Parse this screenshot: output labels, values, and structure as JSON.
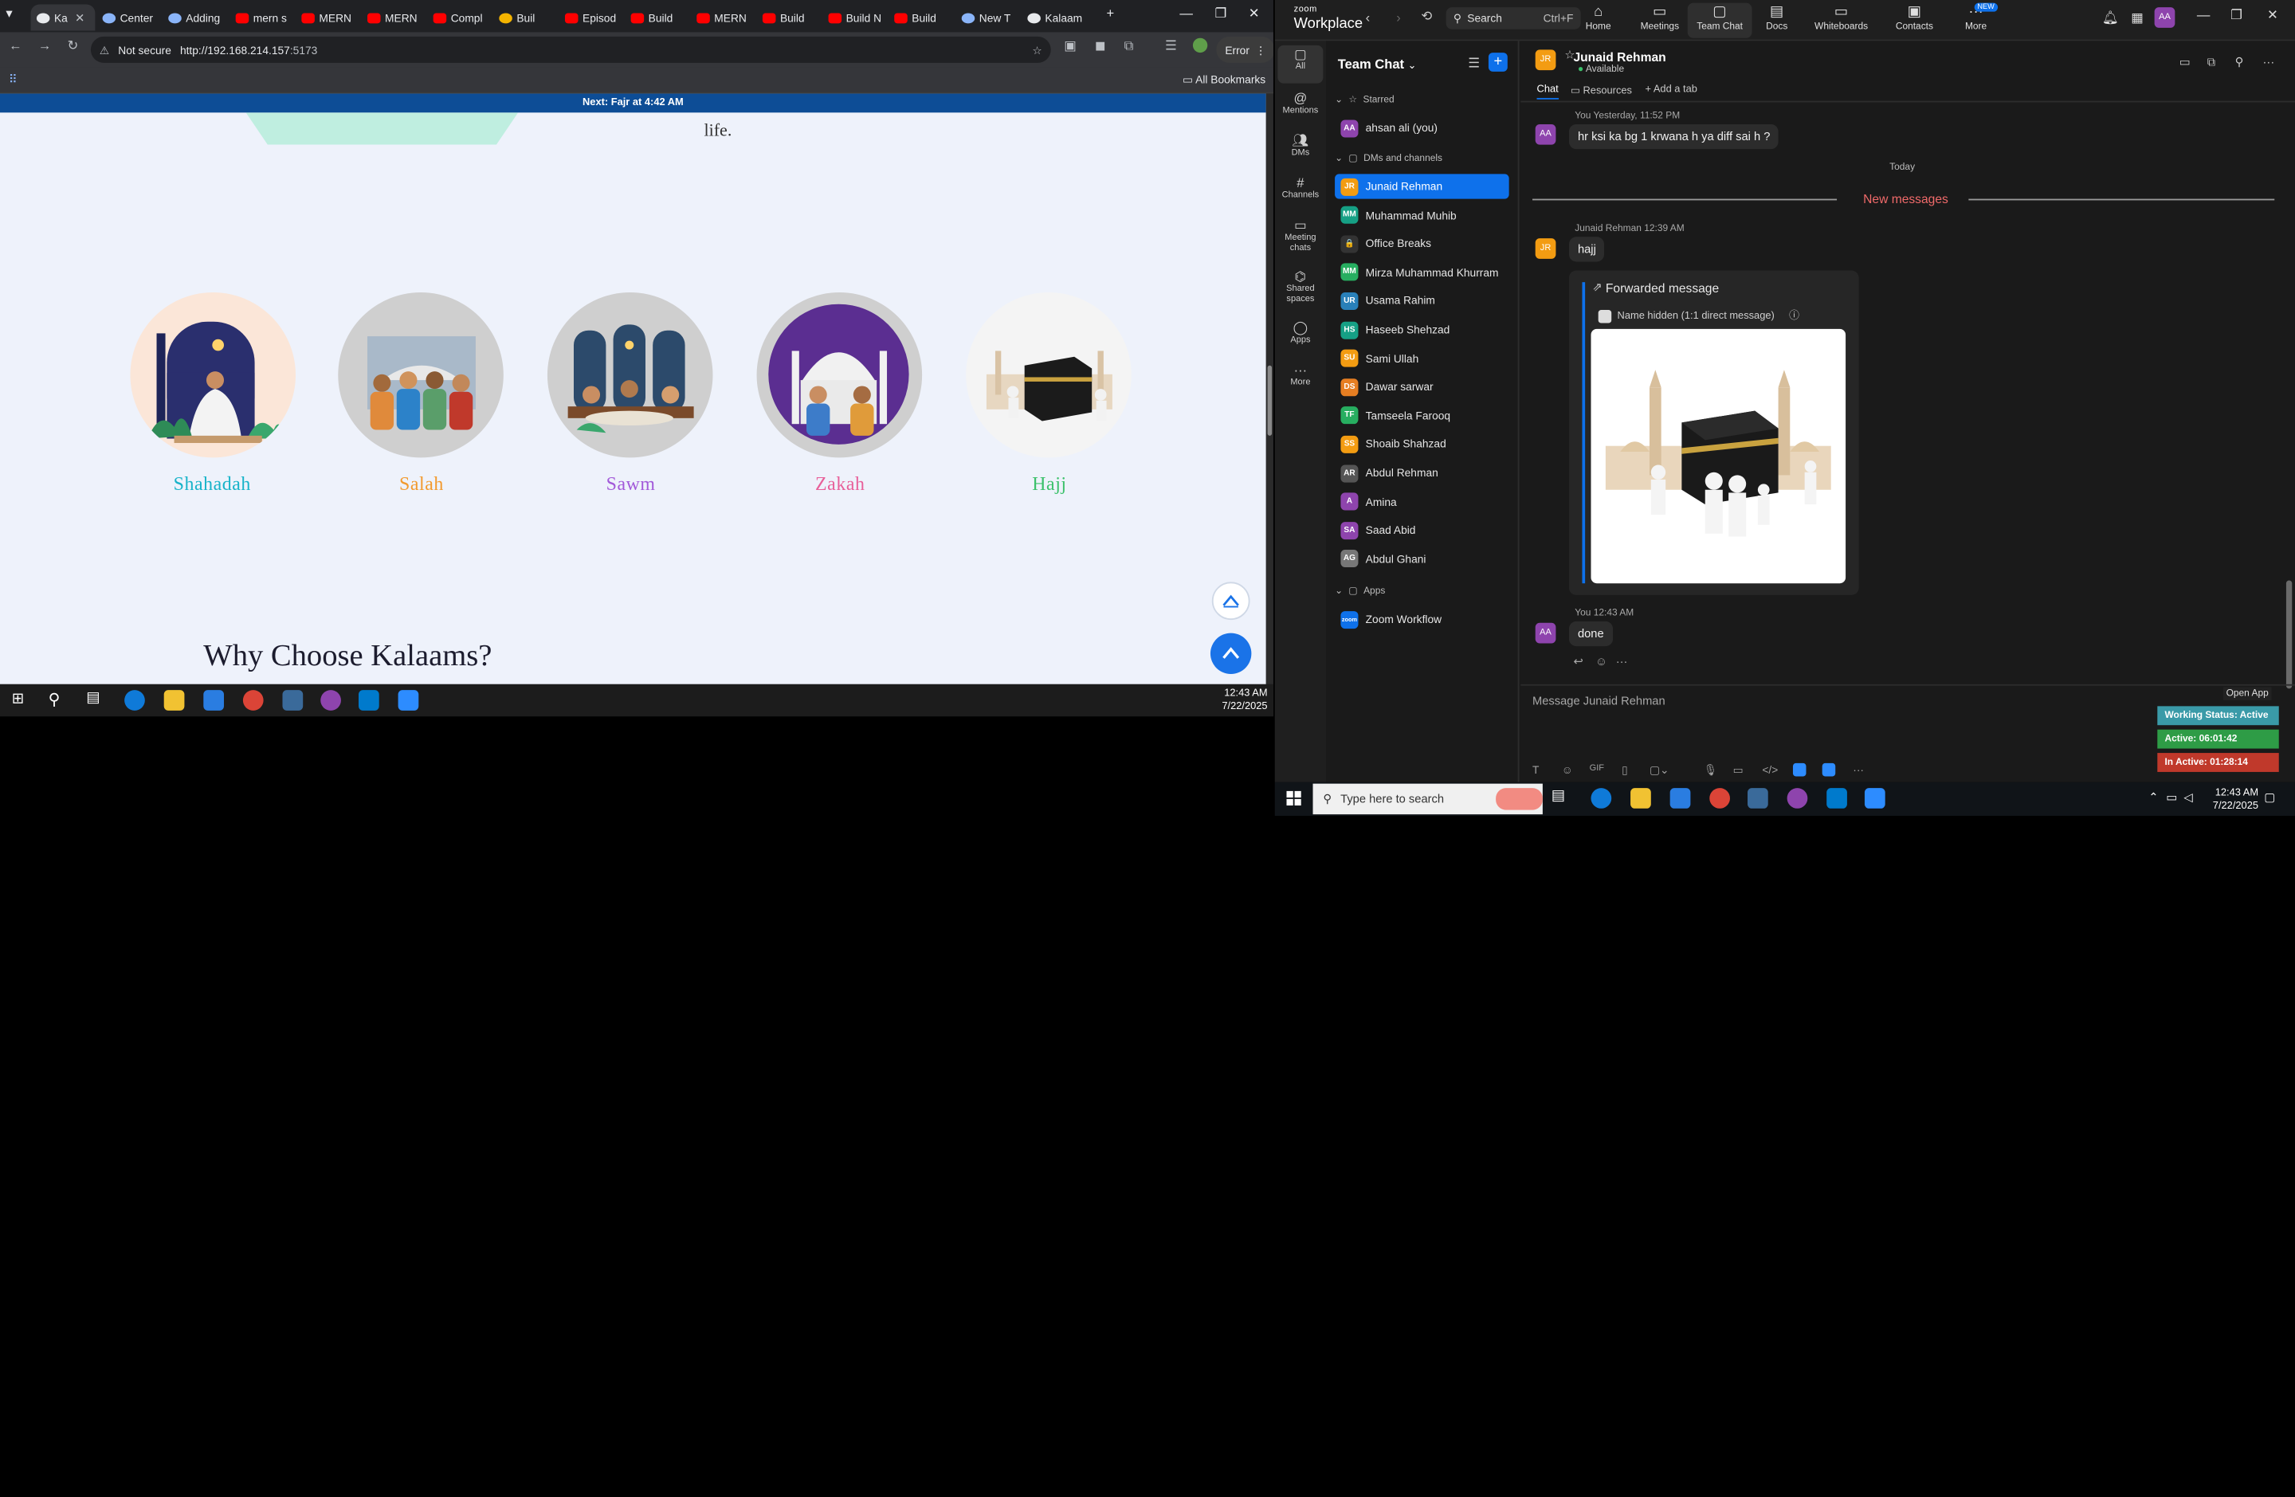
{
  "browser": {
    "tabs": [
      {
        "label": "Ka",
        "fav": "k"
      },
      {
        "label": "Center",
        "fav": "g"
      },
      {
        "label": "Adding",
        "fav": "g"
      },
      {
        "label": "mern s",
        "fav": "y"
      },
      {
        "label": "MERN",
        "fav": "y"
      },
      {
        "label": "MERN",
        "fav": "y"
      },
      {
        "label": "Compl",
        "fav": "y"
      },
      {
        "label": "Buil",
        "fav": "o"
      },
      {
        "label": "Episod",
        "fav": "y"
      },
      {
        "label": "Build",
        "fav": "y"
      },
      {
        "label": "MERN",
        "fav": "y"
      },
      {
        "label": "Build",
        "fav": "y"
      },
      {
        "label": "Build N",
        "fav": "y"
      },
      {
        "label": "Build",
        "fav": "y"
      },
      {
        "label": "New T",
        "fav": "g"
      },
      {
        "label": "Kalaam",
        "fav": "k"
      }
    ],
    "security_label": "Not secure",
    "url_host": "http://192.168.214.157",
    "url_port": ":5173",
    "profile_status": "Error",
    "all_bookmarks": "All Bookmarks"
  },
  "page": {
    "prayer_banner": "Next: Fajr at 4:42 AM",
    "life_text": "life.",
    "pillars": [
      {
        "label": "Shahadah",
        "color": "#17b3c9"
      },
      {
        "label": "Salah",
        "color": "#f29a2e"
      },
      {
        "label": "Sawm",
        "color": "#a259d9"
      },
      {
        "label": "Zakah",
        "color": "#e8609a"
      },
      {
        "label": "Hajj",
        "color": "#3cc16b"
      }
    ],
    "why_heading": "Why Choose Kalaams?"
  },
  "left_taskbar": {
    "time": "12:43 AM",
    "date": "7/22/2025"
  },
  "zoom": {
    "logo_line1": "zoom",
    "logo_line2": "Workplace",
    "search_label": "Search",
    "search_shortcut": "Ctrl+F",
    "nav": [
      {
        "label": "Home",
        "icon": "home-icon"
      },
      {
        "label": "Meetings",
        "icon": "video-icon"
      },
      {
        "label": "Team Chat",
        "icon": "chat-icon"
      },
      {
        "label": "Docs",
        "icon": "doc-icon"
      },
      {
        "label": "Whiteboards",
        "icon": "whiteboard-icon"
      },
      {
        "label": "Contacts",
        "icon": "contacts-icon"
      },
      {
        "label": "More",
        "icon": "more-icon"
      }
    ],
    "new_badge": "NEW",
    "user_initials": "AA",
    "rail": [
      {
        "label": "All"
      },
      {
        "label": "Mentions"
      },
      {
        "label": "DMs"
      },
      {
        "label": "Channels"
      },
      {
        "label": "Meeting chats"
      },
      {
        "label": "Shared spaces"
      },
      {
        "label": "Apps"
      },
      {
        "label": "More"
      }
    ],
    "list_title": "Team Chat",
    "starred_label": "Starred",
    "self_item": {
      "name": "ahsan ali (you)",
      "initials": "AA",
      "color": "#8e44ad"
    },
    "dms_label": "DMs and channels",
    "contacts": [
      {
        "name": "Junaid Rehman",
        "initials": "JR",
        "color": "#f39c12"
      },
      {
        "name": "Muhammad Muhib",
        "initials": "MM",
        "color": "#16a085"
      },
      {
        "name": "Office Breaks",
        "initials": "🔒",
        "color": "#333333"
      },
      {
        "name": "Mirza Muhammad Khurram",
        "initials": "MM",
        "color": "#27ae60"
      },
      {
        "name": "Usama Rahim",
        "initials": "UR",
        "color": "#2980b9"
      },
      {
        "name": "Haseeb Shehzad",
        "initials": "HS",
        "color": "#16a085"
      },
      {
        "name": "Sami Ullah",
        "initials": "SU",
        "color": "#f39c12"
      },
      {
        "name": "Dawar sarwar",
        "initials": "DS",
        "color": "#e67e22"
      },
      {
        "name": "Tamseela Farooq",
        "initials": "TF",
        "color": "#27ae60"
      },
      {
        "name": "Shoaib Shahzad",
        "initials": "SS",
        "color": "#f39c12"
      },
      {
        "name": "Abdul Rehman",
        "initials": "AR",
        "color": "#555555"
      },
      {
        "name": "Amina",
        "initials": "A",
        "color": "#8e44ad"
      },
      {
        "name": "Saad Abid",
        "initials": "SA",
        "color": "#8e44ad"
      },
      {
        "name": "Abdul Ghani",
        "initials": "AG",
        "color": "#777777"
      }
    ],
    "apps_label": "Apps",
    "app_item": {
      "name": "Zoom Workflow",
      "initials": "zoom",
      "color": "#0e71eb"
    },
    "chat": {
      "contact_name": "Junaid Rehman",
      "contact_initials": "JR",
      "status": "Available",
      "tabs": [
        "Chat",
        "Resources",
        "Add a tab"
      ],
      "msg1_meta": "You Yesterday, 11:52 PM",
      "msg1_text": "hr ksi ka bg 1 krwana h ya diff sai h ?",
      "today_label": "Today",
      "new_messages_label": "New messages",
      "msg2_meta": "Junaid Rehman 12:39 AM",
      "msg2_text": "hajj",
      "forwarded_title": "Forwarded message",
      "forwarded_sub": "Name hidden (1:1 direct message)",
      "msg3_meta": "You 12:43 AM",
      "msg3_text": "done",
      "input_placeholder": "Message Junaid Rehman",
      "open_app": "Open App",
      "status_working": "Working Status: Active",
      "status_active": "Active: 06:01:42",
      "status_inactive": "In Active: 01:28:14"
    }
  },
  "right_taskbar": {
    "search_placeholder": "Type here to search",
    "time": "12:43 AM",
    "date": "7/22/2025"
  }
}
